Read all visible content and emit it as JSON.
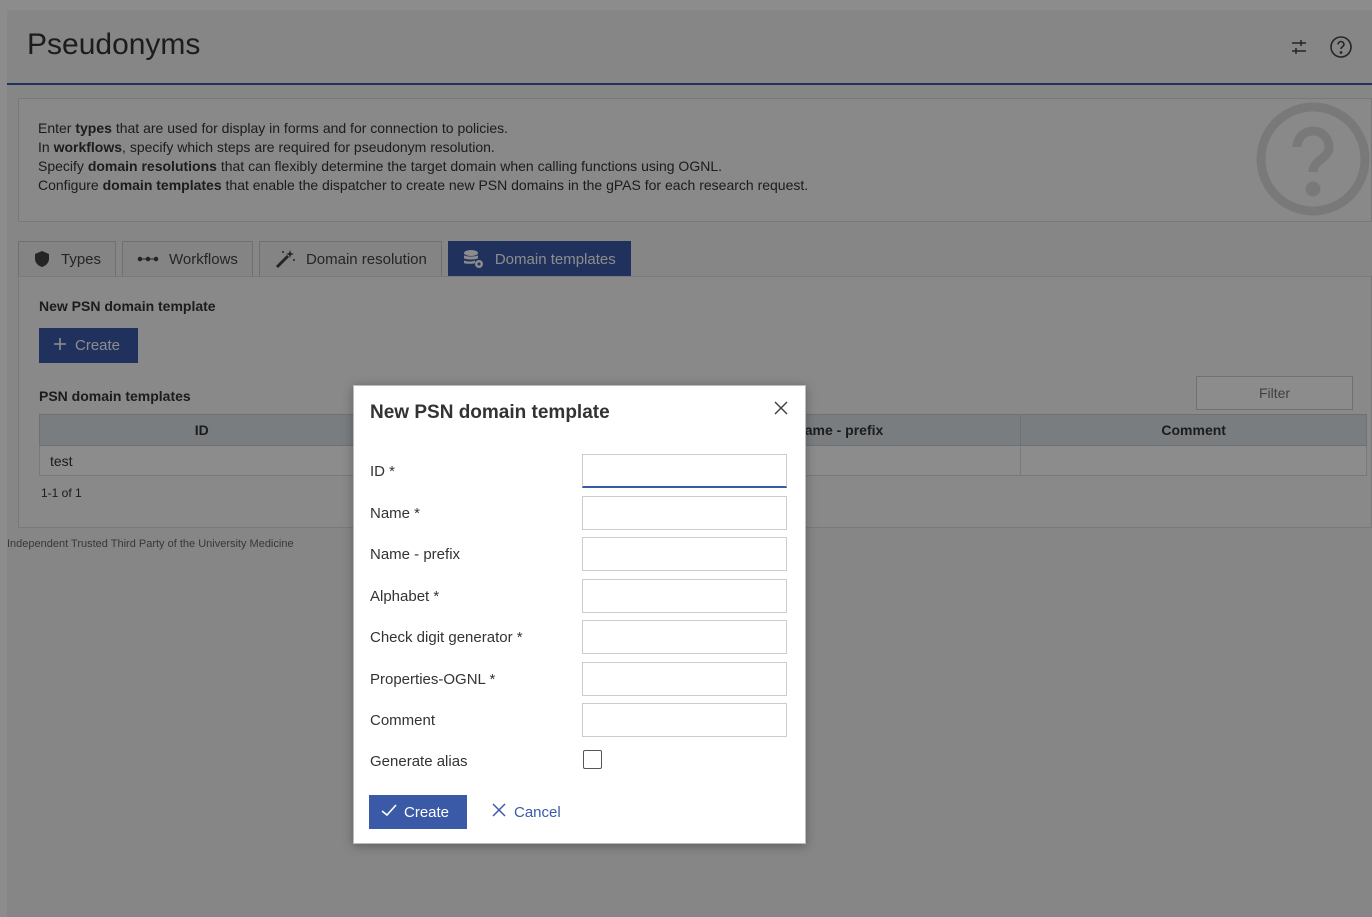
{
  "header": {
    "title": "Pseudonyms"
  },
  "info": {
    "line1": {
      "pre": "Enter ",
      "bold": "types",
      "post": " that are used for display in forms and for connection to policies."
    },
    "line2": {
      "pre": "In ",
      "bold": "workflows",
      "post": ", specify which steps are required for pseudonym resolution."
    },
    "line3": {
      "pre": "Specify ",
      "bold": "domain resolutions",
      "post": " that can flexibly determine the target domain when calling functions using OGNL."
    },
    "line4": {
      "pre": "Configure ",
      "bold": "domain templates",
      "post": " that enable the dispatcher to create new PSN domains in the gPAS for each research request."
    }
  },
  "tabs": [
    {
      "label": "Types",
      "icon": "shield-icon",
      "active": false
    },
    {
      "label": "Workflows",
      "icon": "dots-icon",
      "active": false
    },
    {
      "label": "Domain resolution",
      "icon": "magic-wand-icon",
      "active": false
    },
    {
      "label": "Domain templates",
      "icon": "database-gear-icon",
      "active": true
    }
  ],
  "panel": {
    "new_title": "New PSN domain template",
    "create_label": "Create",
    "list_title": "PSN domain templates",
    "filter_placeholder": "Filter",
    "columns": [
      "ID",
      "Name - prefix",
      "Comment"
    ],
    "rows": [
      {
        "id": "test",
        "name_prefix": "",
        "comment": ""
      }
    ],
    "pager": "1-1 of 1"
  },
  "footer": {
    "text": "Independent Trusted Third Party of the University Medicine"
  },
  "dialog": {
    "title": "New PSN domain template",
    "fields": [
      {
        "label": "ID *",
        "value": ""
      },
      {
        "label": "Name *",
        "value": ""
      },
      {
        "label": "Name - prefix",
        "value": ""
      },
      {
        "label": "Alphabet *",
        "value": ""
      },
      {
        "label": "Check digit generator *",
        "value": ""
      },
      {
        "label": "Properties-OGNL *",
        "value": ""
      },
      {
        "label": "Comment",
        "value": ""
      }
    ],
    "alias_label": "Generate alias",
    "alias_checked": false,
    "create_label": "Create",
    "cancel_label": "Cancel"
  },
  "colors": {
    "accent": "#3a5aa8"
  }
}
